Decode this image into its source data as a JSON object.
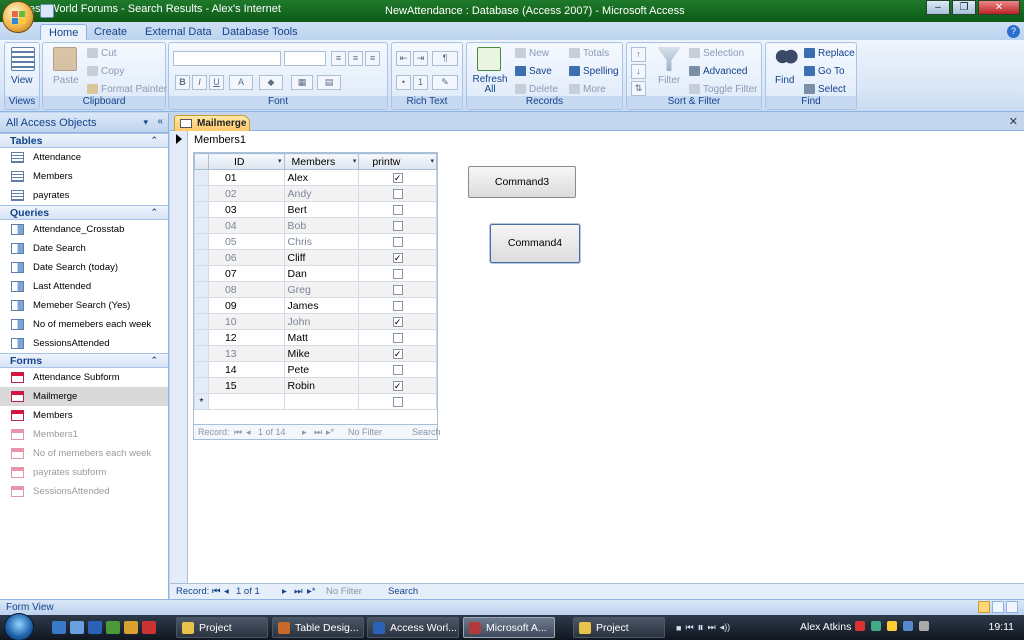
{
  "window": {
    "title_left": "ccess World Forums - Search Results - Alex's Internet",
    "title_center": "NewAttendance : Database (Access 2007) - Microsoft Access",
    "controls": [
      "–",
      "❐",
      "✕"
    ]
  },
  "ribbon": {
    "tabs": [
      "Home",
      "Create",
      "External Data",
      "Database Tools"
    ],
    "active_tab": "Home",
    "help": "?",
    "groups": {
      "views": {
        "label": "Views",
        "view": "View"
      },
      "clipboard": {
        "label": "Clipboard",
        "paste": "Paste",
        "cut": "Cut",
        "copy": "Copy",
        "format_painter": "Format Painter"
      },
      "font": {
        "label": "Font",
        "bold": "B",
        "italic": "I",
        "underline": "U",
        "font_color": "A"
      },
      "rich_text": {
        "label": "Rich Text"
      },
      "records": {
        "label": "Records",
        "refresh": "Refresh All",
        "new": "New",
        "save": "Save",
        "delete": "Delete",
        "totals": "Totals",
        "spelling": "Spelling",
        "more": "More"
      },
      "sort_filter": {
        "label": "Sort & Filter",
        "filter": "Filter",
        "selection": "Selection",
        "advanced": "Advanced",
        "toggle_filter": "Toggle Filter"
      },
      "find": {
        "label": "Find",
        "find": "Find",
        "replace": "Replace",
        "goto": "Go To",
        "select": "Select"
      }
    }
  },
  "nav": {
    "header": "All Access Objects",
    "sections": {
      "tables": {
        "title": "Tables",
        "items": [
          "Attendance",
          "Members",
          "payrates"
        ]
      },
      "queries": {
        "title": "Queries",
        "items": [
          "Attendance_Crosstab",
          "Date Search",
          "Date Search (today)",
          "Last Attended",
          "Memeber Search (Yes)",
          "No of memebers each week",
          "SessionsAttended"
        ]
      },
      "forms": {
        "title": "Forms",
        "items": [
          "Attendance Subform",
          "Mailmerge",
          "Members",
          "Members1",
          "No of memebers each week",
          "payrates subform",
          "SessionsAttended"
        ]
      }
    }
  },
  "document": {
    "tab": "Mailmerge",
    "close": "✕",
    "form_title": "Members1",
    "datasheet": {
      "columns": [
        "ID",
        "Members",
        "printw"
      ],
      "rows": [
        {
          "id": "01",
          "name": "Alex",
          "printw": true
        },
        {
          "id": "02",
          "name": "Andy",
          "printw": false
        },
        {
          "id": "03",
          "name": "Bert",
          "printw": false
        },
        {
          "id": "04",
          "name": "Bob",
          "printw": false
        },
        {
          "id": "05",
          "name": "Chris",
          "printw": false
        },
        {
          "id": "06",
          "name": "Cliff",
          "printw": true
        },
        {
          "id": "07",
          "name": "Dan",
          "printw": false
        },
        {
          "id": "08",
          "name": "Greg",
          "printw": false
        },
        {
          "id": "09",
          "name": "James",
          "printw": false
        },
        {
          "id": "10",
          "name": "John",
          "printw": true
        },
        {
          "id": "12",
          "name": "Matt",
          "printw": false
        },
        {
          "id": "13",
          "name": "Mike",
          "printw": true
        },
        {
          "id": "14",
          "name": "Pete",
          "printw": false
        },
        {
          "id": "15",
          "name": "Robin",
          "printw": true
        }
      ],
      "new_row_marker": "*",
      "record_nav": {
        "label": "Record:",
        "position": "1 of 14",
        "filter": "No Filter",
        "search": "Search"
      }
    },
    "buttons": {
      "command3": "Command3",
      "command4": "Command4"
    },
    "record_nav": {
      "label": "Record:",
      "position": "1 of 1",
      "filter": "No Filter",
      "search": "Search"
    }
  },
  "status": {
    "text": "Form View"
  },
  "taskbar": {
    "items": [
      "Project",
      "Table Desig...",
      "Access Worl...",
      "Microsoft A...",
      "Project"
    ],
    "active_index": 3,
    "user": "Alex Atkins",
    "clock": "19:11"
  }
}
